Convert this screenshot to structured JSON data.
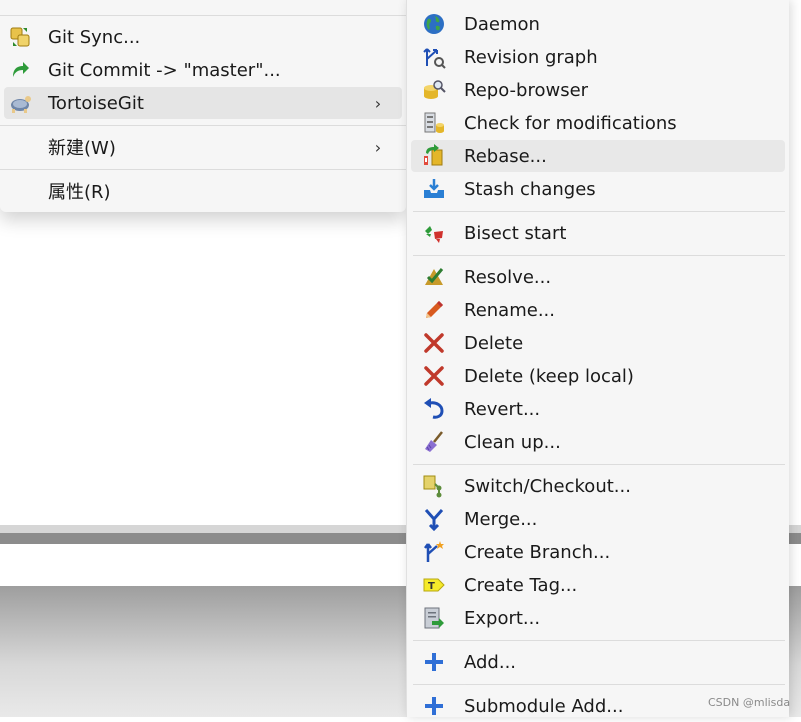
{
  "left_menu": {
    "items": [
      {
        "label": "Git Sync...",
        "icon": "git-sync-icon"
      },
      {
        "label": "Git Commit -> \"master\"...",
        "icon": "git-commit-icon"
      },
      {
        "label": "TortoiseGit",
        "icon": "tortoisegit-icon",
        "chevron": "›"
      },
      {
        "label": "新建(W)",
        "chevron": "›"
      },
      {
        "label": "属性(R)"
      }
    ]
  },
  "submenu": {
    "items": [
      {
        "label": "Daemon",
        "icon": "globe-icon"
      },
      {
        "label": "Revision graph",
        "icon": "revision-graph-icon"
      },
      {
        "label": "Repo-browser",
        "icon": "repo-browser-icon"
      },
      {
        "label": "Check for modifications",
        "icon": "check-modifications-icon"
      },
      {
        "label": "Rebase...",
        "icon": "rebase-icon"
      },
      {
        "label": "Stash changes",
        "icon": "stash-icon"
      },
      {
        "label": "Bisect start",
        "icon": "bisect-icon"
      },
      {
        "label": "Resolve...",
        "icon": "resolve-icon"
      },
      {
        "label": "Rename...",
        "icon": "rename-icon"
      },
      {
        "label": "Delete",
        "icon": "delete-icon"
      },
      {
        "label": "Delete (keep local)",
        "icon": "delete-keep-local-icon"
      },
      {
        "label": "Revert...",
        "icon": "revert-icon"
      },
      {
        "label": "Clean up...",
        "icon": "cleanup-icon"
      },
      {
        "label": "Switch/Checkout...",
        "icon": "switch-checkout-icon"
      },
      {
        "label": "Merge...",
        "icon": "merge-icon"
      },
      {
        "label": "Create Branch...",
        "icon": "create-branch-icon"
      },
      {
        "label": "Create Tag...",
        "icon": "create-tag-icon"
      },
      {
        "label": "Export...",
        "icon": "export-icon"
      },
      {
        "label": "Add...",
        "icon": "add-icon"
      },
      {
        "label": "Submodule Add...",
        "icon": "submodule-add-icon"
      }
    ]
  },
  "watermark": "CSDN @mlisda",
  "colors": {
    "menu_bg": "#f6f6f6",
    "hover_bg": "#e5e5e5",
    "separator": "#dcdcdc",
    "delete_red": "#c0392b",
    "add_blue": "#2f6fd6"
  }
}
